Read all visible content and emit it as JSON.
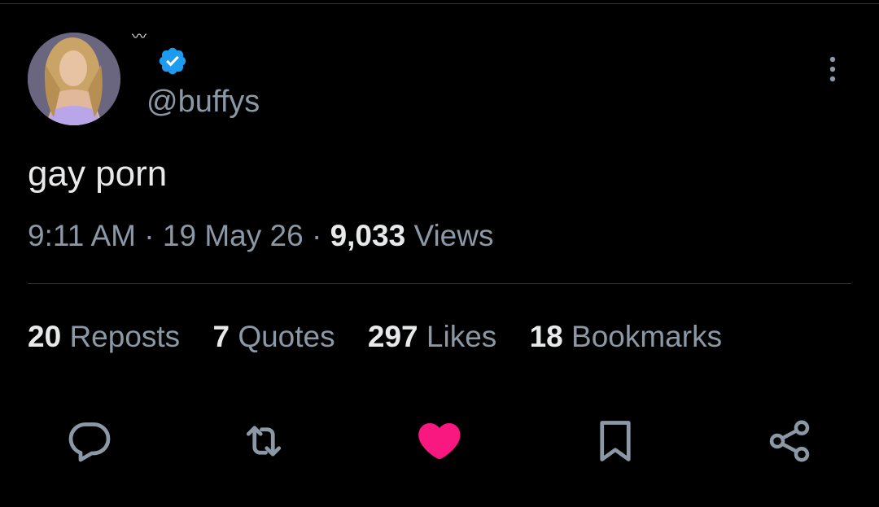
{
  "user": {
    "display_name": "〰",
    "handle": "@buffys",
    "verified": true
  },
  "tweet": {
    "text": "gay porn",
    "time": "9:11 AM",
    "separator": "·",
    "date": "19 May 26",
    "views_count": "9,033",
    "views_label": "Views"
  },
  "stats": [
    {
      "count": "20",
      "label": "Reposts"
    },
    {
      "count": "7",
      "label": "Quotes"
    },
    {
      "count": "297",
      "label": "Likes"
    },
    {
      "count": "18",
      "label": "Bookmarks"
    }
  ],
  "actions": {
    "reply": "reply-icon",
    "repost": "repost-icon",
    "like": "heart-icon",
    "bookmark": "bookmark-icon",
    "share": "share-icon",
    "liked": true
  },
  "colors": {
    "background": "#000000",
    "text_primary": "#e7e9ea",
    "text_secondary": "#8b98a5",
    "verified_blue": "#1d9bf0",
    "like_pink": "#f91880",
    "divider": "#2f3336"
  }
}
